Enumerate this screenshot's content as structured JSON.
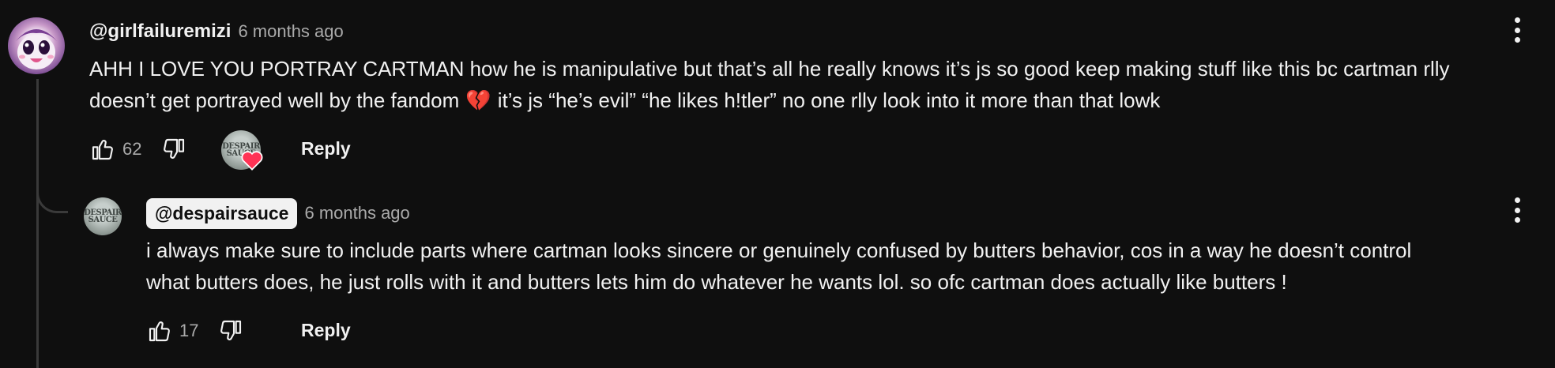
{
  "comment": {
    "handle": "@girlfailuremizi",
    "timestamp": "6 months ago",
    "text_lines": [
      "AHH I LOVE YOU PORTRAY CARTMAN how he is manipulative but that’s all he really knows it’s js so good keep making stuff like this bc cartman rlly",
      "doesn’t get portrayed well by the fandom",
      "it’s js “he’s evil” “he likes h!tler” no one rlly look into it more than that lowk"
    ],
    "emoji": "💔",
    "like_count": "62",
    "reply_label": "Reply",
    "creator_heart_avatar_text": "DESPAIR SAUCE"
  },
  "reply": {
    "handle": "@despairsauce",
    "timestamp": "6 months ago",
    "text_lines": [
      "i always make sure to include parts where cartman looks sincere or genuinely confused by butters behavior, cos in a way he doesn’t control",
      "what butters does, he just rolls with it and butters lets him do whatever he wants lol. so ofc cartman does actually like butters !"
    ],
    "like_count": "17",
    "reply_label": "Reply",
    "avatar_text": "DESPAIR SAUCE"
  },
  "icons": {
    "like": "thumbs-up-icon",
    "dislike": "thumbs-down-icon",
    "menu": "more-vert-icon",
    "heart": "heart-icon"
  },
  "colors": {
    "background": "#0f0f0f",
    "text": "#f1f1f1",
    "secondary_text": "#aaaaaa",
    "heart": "#ff3355"
  }
}
